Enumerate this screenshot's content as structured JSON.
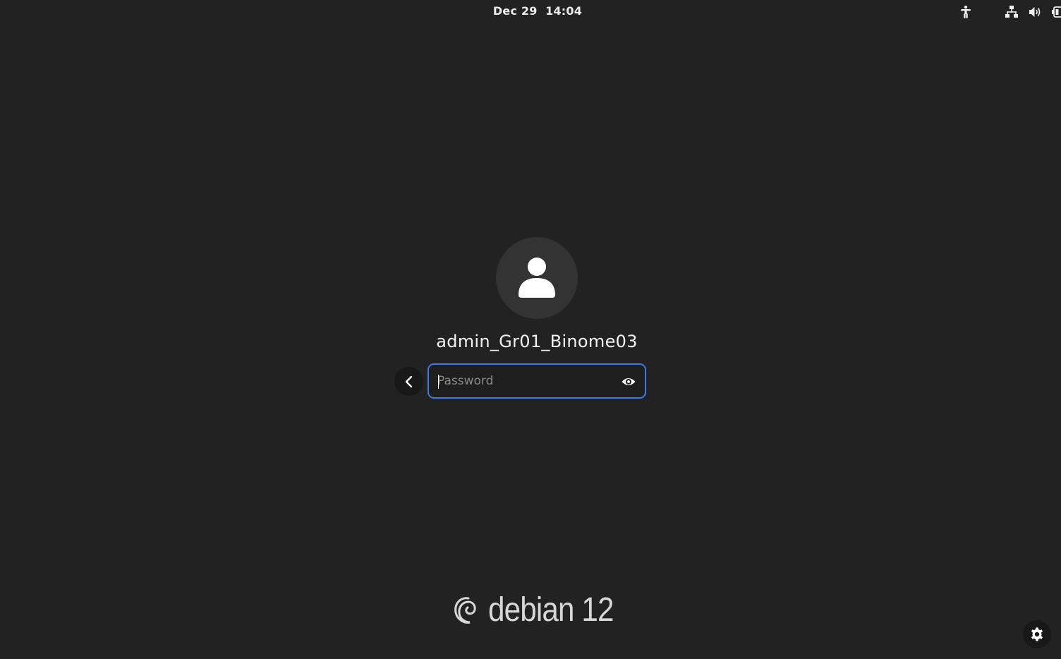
{
  "top_bar": {
    "date": "Dec 29",
    "time": "14:04",
    "icons": [
      "accessibility-icon",
      "network-wired-icon",
      "volume-icon",
      "battery-icon"
    ]
  },
  "login": {
    "avatar_icon": "user-avatar-icon",
    "username": "admin_Gr01_Binome03",
    "password_placeholder": "Password",
    "password_value": "",
    "back_icon": "chevron-left-icon",
    "reveal_icon": "eye-icon"
  },
  "branding": {
    "logo_icon": "debian-swirl-icon",
    "text": "debian 12"
  },
  "settings_icon": "gear-icon",
  "colors": {
    "background": "#222222",
    "focus_border": "#3d7be0",
    "avatar_bg": "#333333"
  }
}
